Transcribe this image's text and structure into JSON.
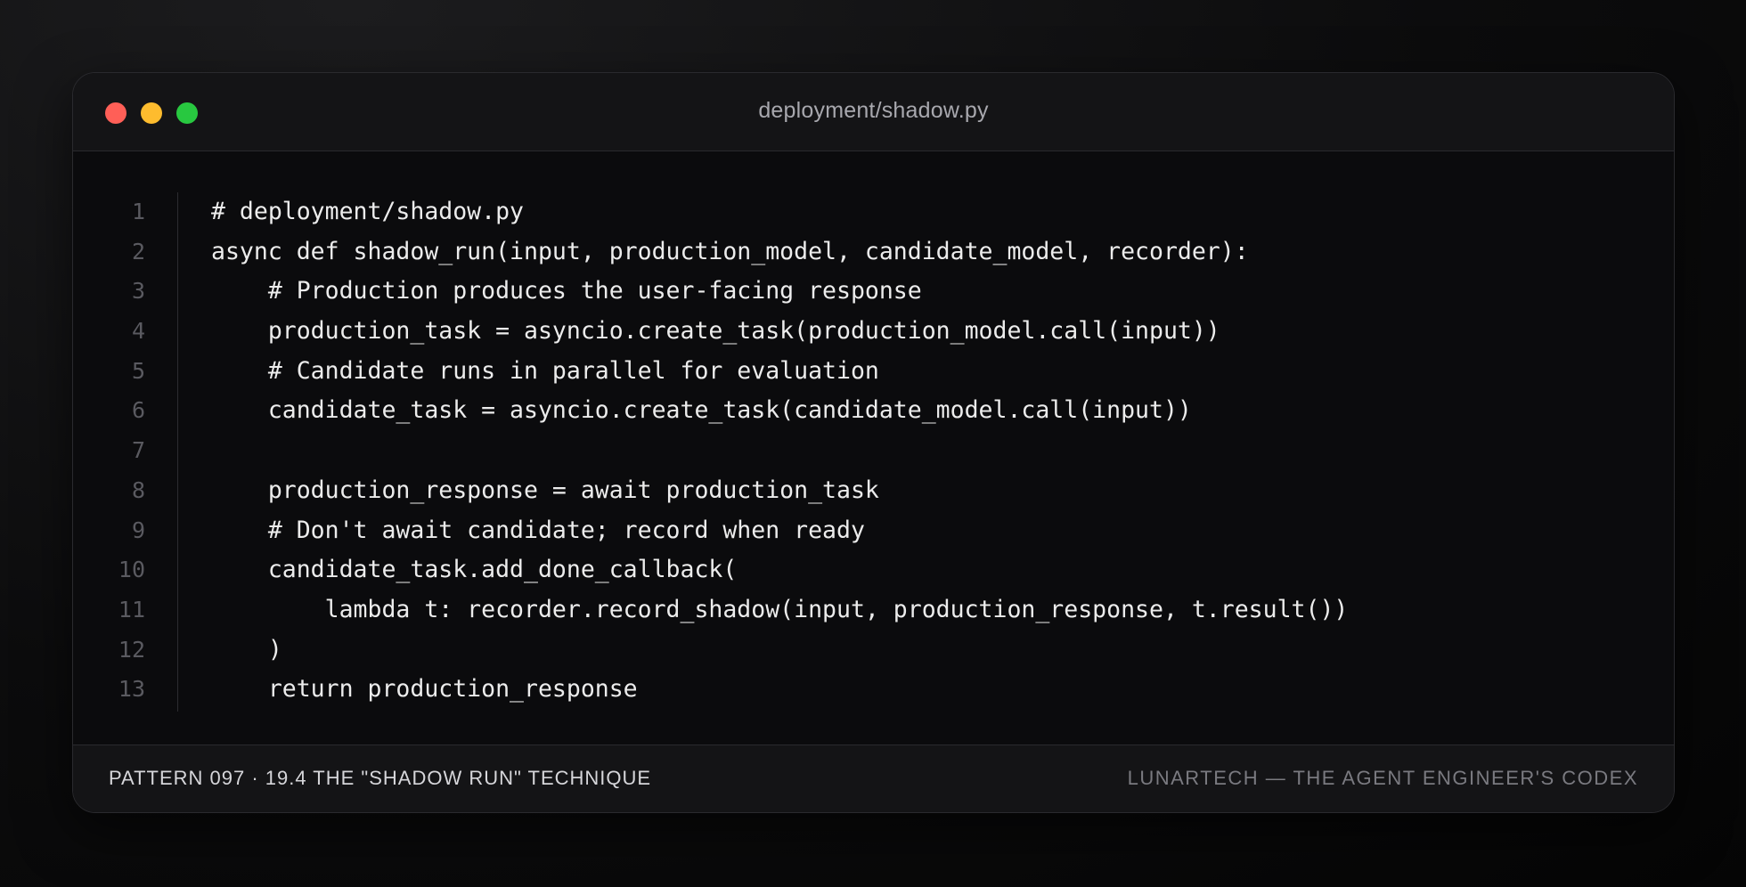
{
  "window": {
    "title": "deployment/shadow.py",
    "controls": [
      "close",
      "minimize",
      "maximize"
    ],
    "colors": {
      "close": "#ff5f57",
      "minimize": "#febc2e",
      "maximize": "#28c840",
      "background": "#0b0b0d",
      "text": "#ececec"
    }
  },
  "code": {
    "lines": [
      {
        "n": "1",
        "text": "# deployment/shadow.py"
      },
      {
        "n": "2",
        "text": "async def shadow_run(input, production_model, candidate_model, recorder):"
      },
      {
        "n": "3",
        "text": "    # Production produces the user-facing response"
      },
      {
        "n": "4",
        "text": "    production_task = asyncio.create_task(production_model.call(input))"
      },
      {
        "n": "5",
        "text": "    # Candidate runs in parallel for evaluation"
      },
      {
        "n": "6",
        "text": "    candidate_task = asyncio.create_task(candidate_model.call(input))"
      },
      {
        "n": "7",
        "text": ""
      },
      {
        "n": "8",
        "text": "    production_response = await production_task"
      },
      {
        "n": "9",
        "text": "    # Don't await candidate; record when ready"
      },
      {
        "n": "10",
        "text": "    candidate_task.add_done_callback("
      },
      {
        "n": "11",
        "text": "        lambda t: recorder.record_shadow(input, production_response, t.result())"
      },
      {
        "n": "12",
        "text": "    )"
      },
      {
        "n": "13",
        "text": "    return production_response"
      }
    ]
  },
  "footer": {
    "left": "PATTERN 097 · 19.4 THE \"SHADOW RUN\" TECHNIQUE",
    "right": "LUNARTECH — THE AGENT ENGINEER'S CODEX"
  }
}
